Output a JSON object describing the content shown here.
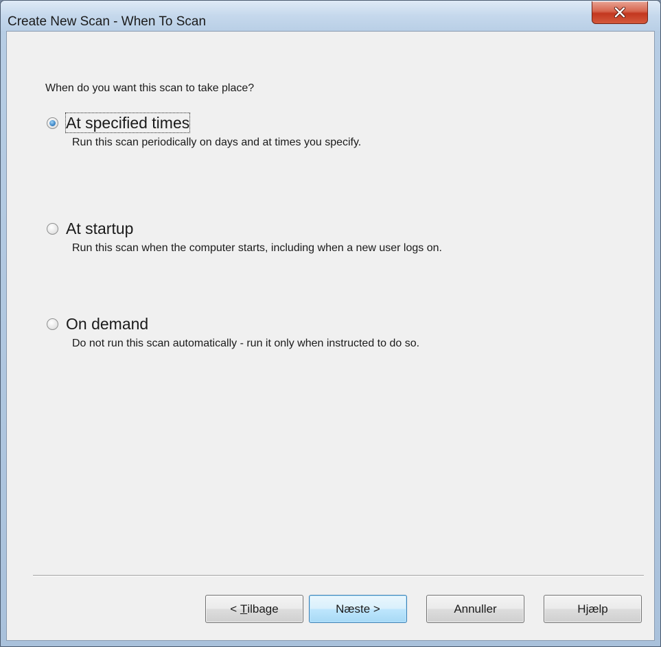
{
  "window": {
    "title": "Create New Scan - When To Scan",
    "close_icon": "close-icon"
  },
  "main": {
    "question": "When do you want this scan to take place?",
    "options": [
      {
        "label": "At specified times",
        "description": "Run this scan periodically on days and at times you specify.",
        "selected": true
      },
      {
        "label": "At startup",
        "description": "Run this scan when the computer starts, including when a new user logs on.",
        "selected": false
      },
      {
        "label": "On demand",
        "description": "Do not run this scan automatically - run it only when instructed to do so.",
        "selected": false
      }
    ]
  },
  "buttons": {
    "back_prefix": "< ",
    "back_mnemonic": "T",
    "back_rest": "ilbage",
    "next": "Næste >",
    "cancel": "Annuller",
    "help": "Hjælp"
  }
}
